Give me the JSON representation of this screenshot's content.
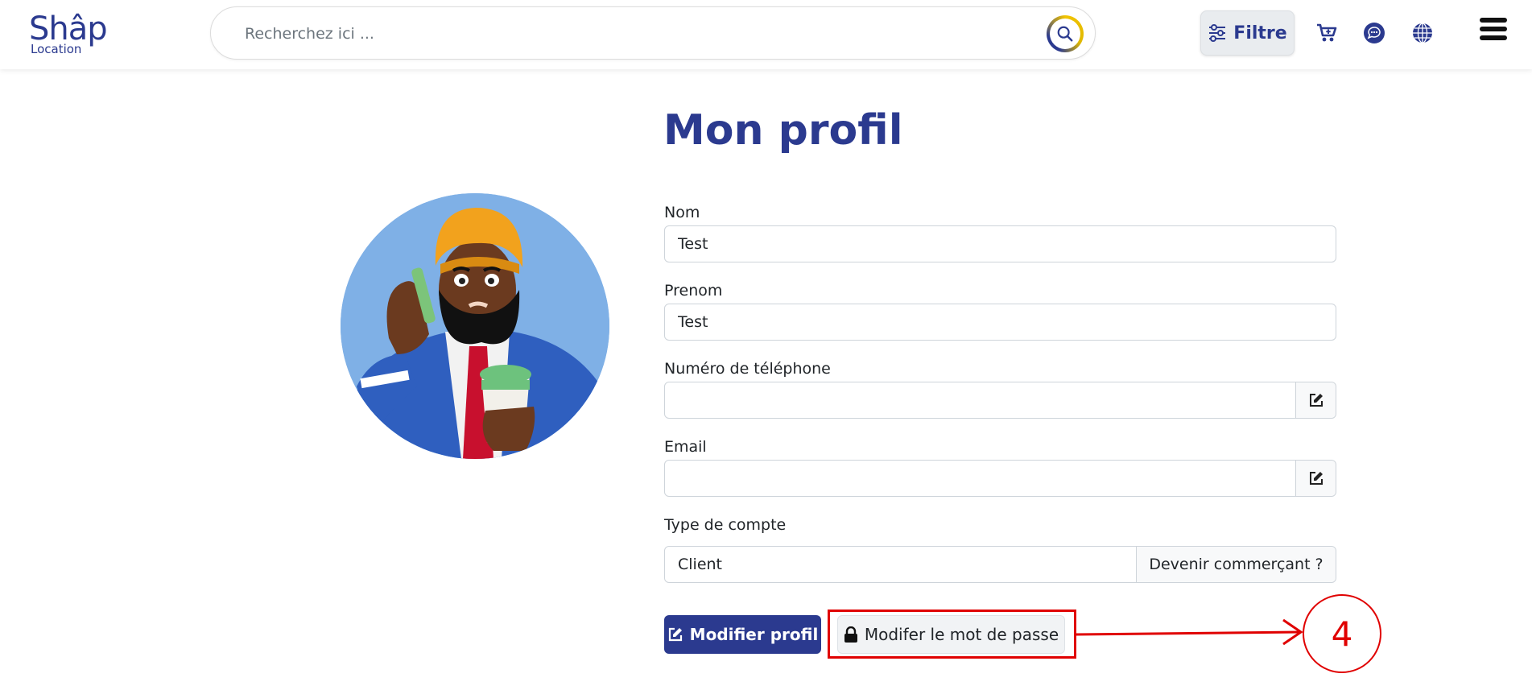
{
  "header": {
    "logo_main": "Shâp",
    "logo_sub": "Location",
    "search_placeholder": "Recherchez ici ...",
    "filter_label": "Filtre"
  },
  "page": {
    "title": "Mon profil"
  },
  "form": {
    "nom_label": "Nom",
    "nom_value": "Test",
    "prenom_label": "Prenom",
    "prenom_value": "Test",
    "phone_label": "Numéro de téléphone",
    "phone_value": "",
    "email_label": "Email",
    "email_value": "",
    "account_type_label": "Type de compte",
    "account_type_value": "Client",
    "become_merchant_label": "Devenir commerçant ?",
    "edit_profile_label": "Modifier profil",
    "change_password_label": "Modifer le mot de passe"
  },
  "annotation": {
    "step_number": "4"
  }
}
